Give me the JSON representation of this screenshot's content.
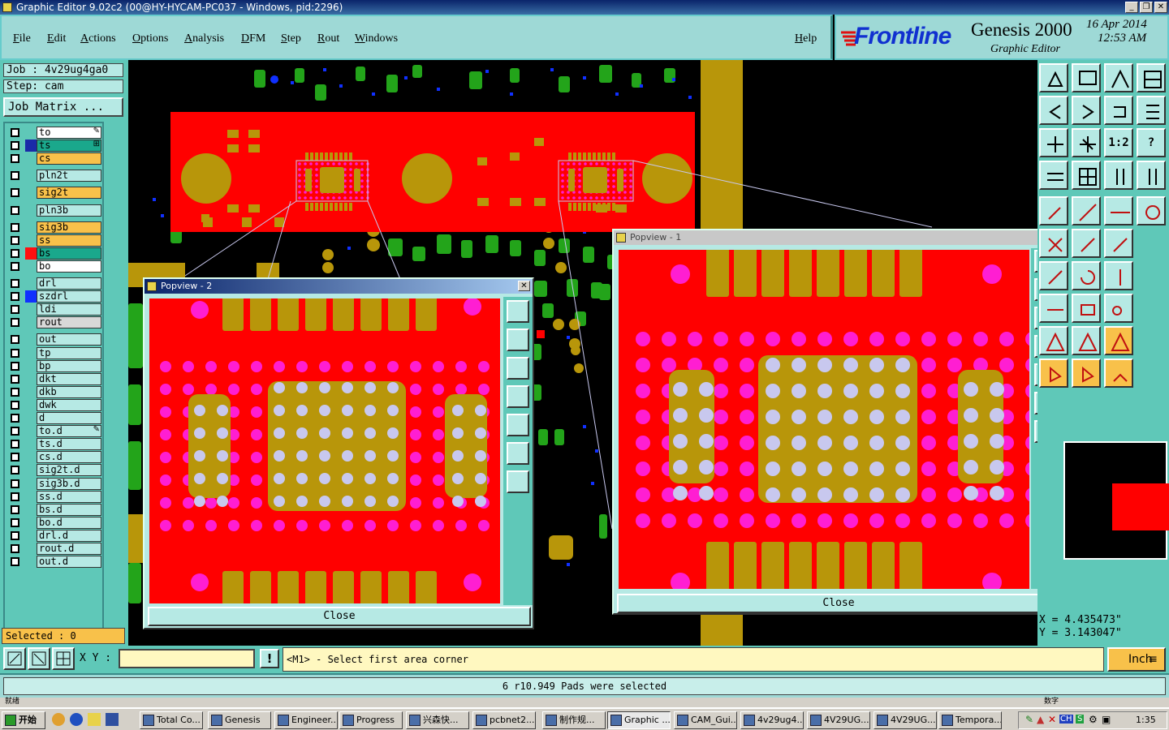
{
  "window": {
    "title": "Graphic Editor 9.02c2 (00@HY-HYCAM-PC037 - Windows, pid:2296)",
    "controls": [
      "_",
      "❐",
      "✕"
    ]
  },
  "menu": {
    "items": [
      "File",
      "Edit",
      "Actions",
      "Options",
      "Analysis",
      "DFM",
      "Step",
      "Rout",
      "Windows"
    ],
    "help": "Help"
  },
  "brand": {
    "logo": "Frontline",
    "product": "Genesis 2000",
    "subtitle": "Graphic Editor",
    "date": "16 Apr 2014",
    "time": "12:53 AM"
  },
  "job": {
    "job_line": "Job : 4v29ug4ga0",
    "step_line": "Step: cam",
    "matrix_button": "Job Matrix ..."
  },
  "layers": [
    {
      "name": "to",
      "bg": "#ffffff",
      "swatch": "",
      "marker": "✎"
    },
    {
      "name": "ts",
      "bg": "#1aa88c",
      "swatch": "#1a2aa8",
      "marker": "⊞"
    },
    {
      "name": "cs",
      "bg": "#f8c14a",
      "swatch": "",
      "marker": ""
    },
    {
      "name": "pln2t",
      "bg": "#b6e9e4",
      "swatch": "",
      "marker": ""
    },
    {
      "name": "sig2t",
      "bg": "#f8c14a",
      "swatch": "",
      "marker": ""
    },
    {
      "name": "pln3b",
      "bg": "#b6e9e4",
      "swatch": "",
      "marker": ""
    },
    {
      "name": "sig3b",
      "bg": "#f8c14a",
      "swatch": "",
      "marker": ""
    },
    {
      "name": "ss",
      "bg": "#f8c14a",
      "swatch": "",
      "marker": ""
    },
    {
      "name": "bs",
      "bg": "#1aa88c",
      "swatch": "#ff1010",
      "marker": ""
    },
    {
      "name": "bo",
      "bg": "#ffffff",
      "swatch": "",
      "marker": ""
    },
    {
      "name": "drl",
      "bg": "#b6e9e4",
      "swatch": "",
      "marker": ""
    },
    {
      "name": "szdrl",
      "bg": "#b6e9e4",
      "swatch": "#1030ff",
      "marker": ""
    },
    {
      "name": "ldi",
      "bg": "#b6e9e4",
      "swatch": "",
      "marker": ""
    },
    {
      "name": "rout",
      "bg": "#d8d8d8",
      "swatch": "",
      "marker": ""
    },
    {
      "name": "out",
      "bg": "#b6e9e4",
      "swatch": "",
      "marker": ""
    },
    {
      "name": "tp",
      "bg": "#b6e9e4",
      "swatch": "",
      "marker": ""
    },
    {
      "name": "bp",
      "bg": "#b6e9e4",
      "swatch": "",
      "marker": ""
    },
    {
      "name": "dkt",
      "bg": "#b6e9e4",
      "swatch": "",
      "marker": ""
    },
    {
      "name": "dkb",
      "bg": "#b6e9e4",
      "swatch": "",
      "marker": ""
    },
    {
      "name": "dwk",
      "bg": "#b6e9e4",
      "swatch": "",
      "marker": ""
    },
    {
      "name": "d",
      "bg": "#b6e9e4",
      "swatch": "",
      "marker": ""
    },
    {
      "name": "to.d",
      "bg": "#b6e9e4",
      "swatch": "",
      "marker": "✎"
    },
    {
      "name": "ts.d",
      "bg": "#b6e9e4",
      "swatch": "",
      "marker": ""
    },
    {
      "name": "cs.d",
      "bg": "#b6e9e4",
      "swatch": "",
      "marker": ""
    },
    {
      "name": "sig2t.d",
      "bg": "#b6e9e4",
      "swatch": "",
      "marker": ""
    },
    {
      "name": "sig3b.d",
      "bg": "#b6e9e4",
      "swatch": "",
      "marker": ""
    },
    {
      "name": "ss.d",
      "bg": "#b6e9e4",
      "swatch": "",
      "marker": ""
    },
    {
      "name": "bs.d",
      "bg": "#b6e9e4",
      "swatch": "",
      "marker": ""
    },
    {
      "name": "bo.d",
      "bg": "#b6e9e4",
      "swatch": "",
      "marker": ""
    },
    {
      "name": "drl.d",
      "bg": "#b6e9e4",
      "swatch": "",
      "marker": ""
    },
    {
      "name": "rout.d",
      "bg": "#b6e9e4",
      "swatch": "",
      "marker": ""
    },
    {
      "name": "out.d",
      "bg": "#b6e9e4",
      "swatch": "",
      "marker": ""
    }
  ],
  "selected": "Selected : 0",
  "popup2": {
    "title": "Popview - 2",
    "close": "Close"
  },
  "popup1": {
    "title": "Popview - 1",
    "close": "Close"
  },
  "toolbar": {
    "one_to_two": "1:2",
    "help": "?",
    "icons": [
      "zoom-home-icon",
      "zoom-in-icon",
      "zoom-reset-icon",
      "redraw-icon",
      "pan-left-icon",
      "pan-right-icon",
      "undo-icon",
      "redo-icon",
      "fit-icon",
      "center-icon",
      "scale-icon",
      "help-icon",
      "measure-icon",
      "grid-icon",
      "snap-icon",
      "snap-alt-icon"
    ]
  },
  "coords": {
    "x": "X = 4.435473\"",
    "y": "Y = 3.143047\""
  },
  "cmd": {
    "xy_label": "X Y :",
    "xy_value": "",
    "warning": "!",
    "prompt": "<M1> - Select first area corner",
    "units": "Inch"
  },
  "status": "6 r10.949 Pads were selected",
  "status_left": "就绪",
  "status_right": "数字",
  "taskbar": {
    "start": "开始",
    "tasks": [
      "Total Co...",
      "Genesis",
      "Engineer...",
      "Progress",
      "兴森快...",
      "pcbnet2...",
      "制作规...",
      "Graphic ...",
      "CAM_Gui...",
      "4v29ug4...",
      "4V29UG...",
      "4V29UG...",
      "Tempora..."
    ],
    "active_task": 7,
    "clock": "1:35"
  },
  "colors": {
    "board": "#ff0000",
    "copper": "#b8960a",
    "pad_pink": "#ff1ed2",
    "pad_light": "#c8c8ee",
    "teal": "#5fc8b8",
    "green": "#23a41a",
    "via_blue": "#1030ff"
  }
}
